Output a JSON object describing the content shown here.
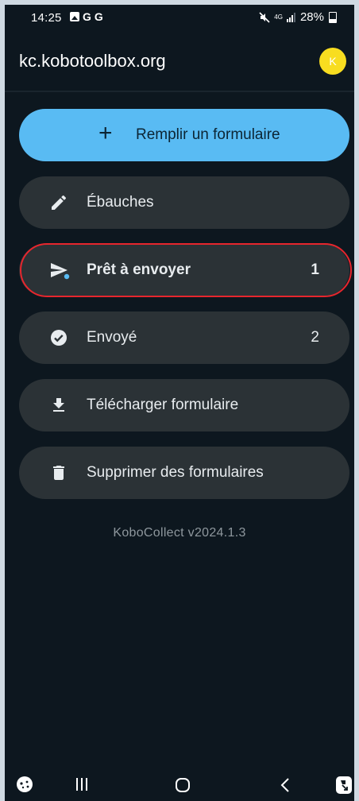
{
  "status_bar": {
    "time": "14:25",
    "notif_letters": [
      "G",
      "G"
    ],
    "network": "4G",
    "battery": "28%"
  },
  "app_bar": {
    "title": "kc.kobotoolbox.org",
    "avatar_initial": "K"
  },
  "menu": {
    "fill_form": {
      "label": "Remplir un formulaire",
      "icon": "plus-icon"
    },
    "items": [
      {
        "label": "Ébauches",
        "icon": "pencil-icon",
        "count": ""
      },
      {
        "label": "Prêt à envoyer",
        "icon": "send-icon",
        "count": "1"
      },
      {
        "label": "Envoyé",
        "icon": "check-circle-icon",
        "count": "2"
      },
      {
        "label": "Télécharger formulaire",
        "icon": "download-icon",
        "count": ""
      },
      {
        "label": "Supprimer des formulaires",
        "icon": "trash-icon",
        "count": ""
      }
    ]
  },
  "version": "KoboCollect v2024.1.3",
  "colors": {
    "background": "#0d171f",
    "primary": "#59bbf3",
    "button": "#2b3236",
    "highlight_ring": "#e7262d",
    "avatar": "#f8dd20"
  }
}
